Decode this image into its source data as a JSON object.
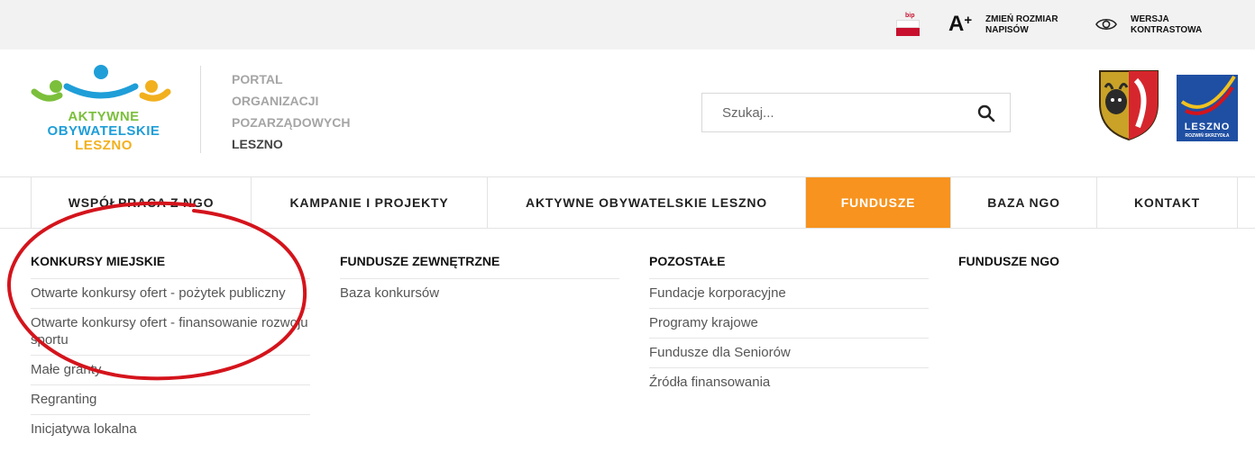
{
  "topbar": {
    "bip_label": "bip",
    "font_size_symbol": "A",
    "font_size_plus": "+",
    "font_size_label_line1": "ZMIEŃ ROZMIAR",
    "font_size_label_line2": "NAPISÓW",
    "contrast_label_line1": "WERSJA",
    "contrast_label_line2": "KONTRASTOWA"
  },
  "logo": {
    "line1": "AKTYWNE",
    "line2": "OBYWATELSKIE",
    "line3": "LESZNO"
  },
  "portal": {
    "line1": "PORTAL",
    "line2": "ORGANIZACJI",
    "line3": "POZARZĄDOWYCH",
    "line4": "LESZNO"
  },
  "search": {
    "placeholder": "Szukaj..."
  },
  "partner_logo": {
    "name": "LESZNO",
    "tagline": "ROZWIŃ SKRZYDŁA"
  },
  "nav": {
    "items": [
      {
        "label": "WSPÓŁPRACA Z NGO"
      },
      {
        "label": "KAMPANIE I PROJEKTY"
      },
      {
        "label": "AKTYWNE OBYWATELSKIE LESZNO"
      },
      {
        "label": "FUNDUSZE",
        "active": true
      },
      {
        "label": "BAZA NGO"
      },
      {
        "label": "KONTAKT"
      }
    ]
  },
  "menu": {
    "columns": [
      {
        "title": "KONKURSY MIEJSKIE",
        "items": [
          "Otwarte konkursy ofert - pożytek publiczny",
          "Otwarte konkursy ofert - finansowanie rozwoju sportu",
          "Małe granty",
          "Regranting",
          "Inicjatywa lokalna"
        ]
      },
      {
        "title": "FUNDUSZE ZEWNĘTRZNE",
        "items": [
          "Baza konkursów"
        ]
      },
      {
        "title": "POZOSTAŁE",
        "items": [
          "Fundacje korporacyjne",
          "Programy krajowe",
          "Fundusze dla Seniorów",
          "Źródła finansowania"
        ]
      },
      {
        "title": "FUNDUSZE NGO",
        "items": []
      }
    ]
  },
  "colors": {
    "accent_orange": "#f7931e",
    "annotation_red": "#d4141c",
    "logo_green": "#7bbf3b",
    "logo_blue": "#1f9ed8",
    "logo_yellow": "#f2b01e"
  }
}
